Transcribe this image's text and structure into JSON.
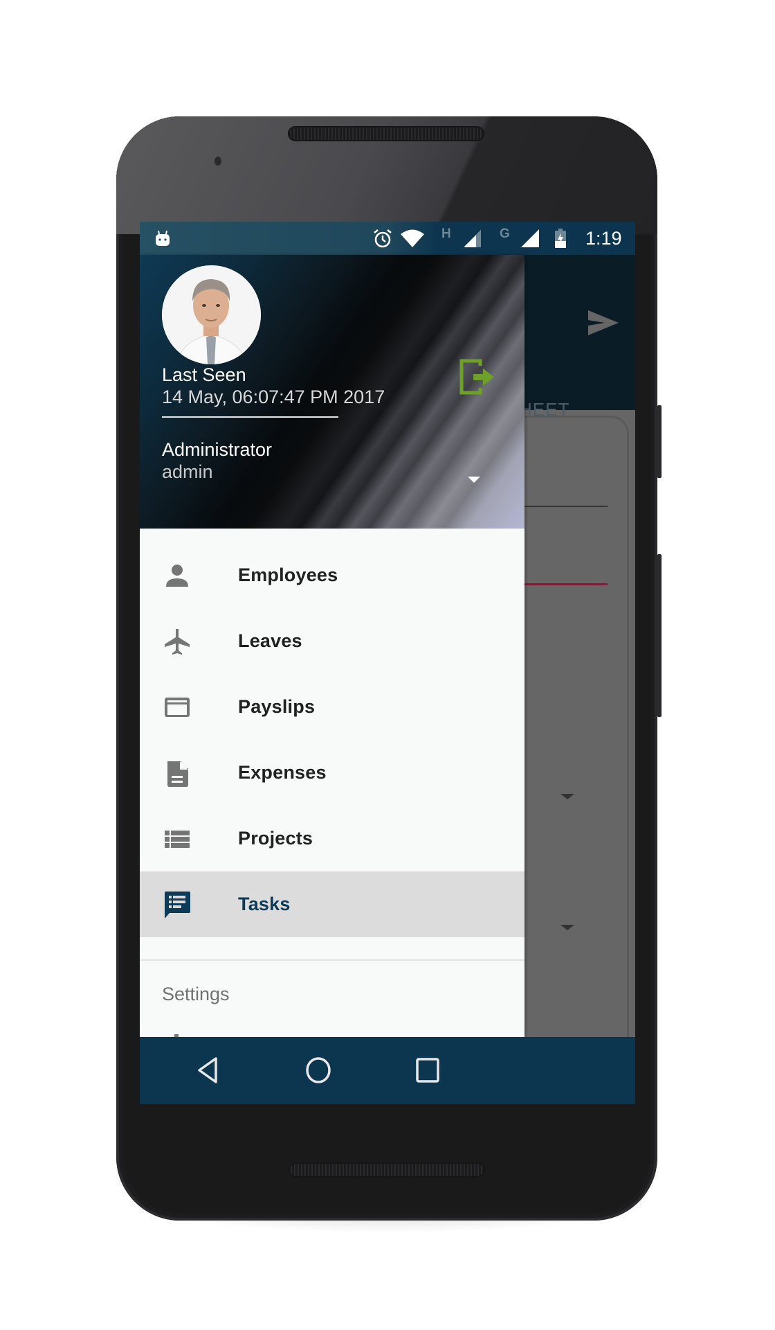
{
  "status_bar": {
    "notification_icon": "android-debug-icon",
    "icons": [
      "alarm-icon",
      "wifi-icon",
      "signal-h-icon",
      "signal-g-icon",
      "battery-charging-icon"
    ],
    "network_type_1": "H",
    "network_type_2": "G",
    "time": "1:19"
  },
  "background_app": {
    "action_icon": "send-icon",
    "tab_label_partial": "HEET",
    "accent_color": "#7a1f35"
  },
  "drawer": {
    "header": {
      "avatar": "user-photo",
      "last_seen_label": "Last Seen",
      "last_seen_value": "14 May, 06:07:47 PM 2017",
      "user_name": "Administrator",
      "user_login": "admin",
      "logout_icon": "logout-icon",
      "logout_color": "#6fa12a",
      "account_toggle_icon": "dropdown-arrow-icon"
    },
    "menu": [
      {
        "label": "Employees",
        "icon": "person-icon",
        "active": false
      },
      {
        "label": "Leaves",
        "icon": "airplane-icon",
        "active": false
      },
      {
        "label": "Payslips",
        "icon": "credit-card-icon",
        "active": false
      },
      {
        "label": "Expenses",
        "icon": "document-icon",
        "active": false
      },
      {
        "label": "Projects",
        "icon": "list-icon",
        "active": false
      },
      {
        "label": "Tasks",
        "icon": "task-chat-icon",
        "active": true
      }
    ],
    "section_label": "Settings",
    "active_color": "#0d3a57"
  },
  "nav_bar": {
    "back": "back-icon",
    "home": "home-icon",
    "recents": "recents-icon"
  }
}
